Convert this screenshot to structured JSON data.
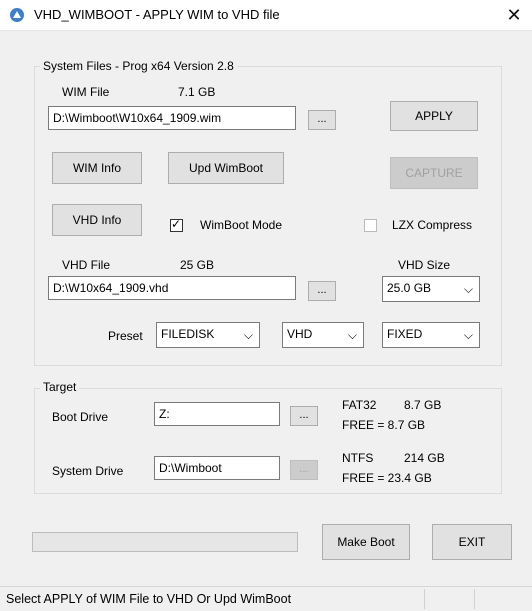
{
  "window": {
    "title": "VHD_WIMBOOT - APPLY WIM to VHD file",
    "close_glyph": "✕"
  },
  "system_files": {
    "legend": "System Files - Prog x64 Version 2.8",
    "wim_label": "WIM File",
    "wim_size": "7.1 GB",
    "wim_path": "D:\\Wimboot\\W10x64_1909.wim",
    "browse_label": "...",
    "apply_label": "APPLY",
    "wim_info_label": "WIM Info",
    "upd_wimboot_label": "Upd WimBoot",
    "capture_label": "CAPTURE",
    "vhd_info_label": "VHD Info",
    "wimboot_mode_label": "WimBoot Mode",
    "lzx_label": "LZX Compress",
    "vhd_label": "VHD File",
    "vhd_size": "25 GB",
    "vhd_size_label": "VHD Size",
    "vhd_path": "D:\\W10x64_1909.vhd",
    "vhd_size_value": "25.0 GB",
    "preset_label": "Preset",
    "preset_value": "FILEDISK",
    "type_value": "VHD",
    "mode_value": "FIXED",
    "chevron": "⌵",
    "check_glyph": "✓"
  },
  "target": {
    "legend": "Target",
    "boot_label": "Boot Drive",
    "boot_value": "Z:",
    "boot_fs": "FAT32",
    "boot_total": "8.7 GB",
    "boot_free": "FREE  = 8.7 GB",
    "system_label": "System Drive",
    "system_value": "D:\\Wimboot",
    "system_fs": "NTFS",
    "system_total": "214 GB",
    "system_free": "FREE  = 23.4 GB",
    "browse_label": "..."
  },
  "actions": {
    "make_boot_label": "Make Boot",
    "exit_label": "EXIT",
    "progress": 0
  },
  "status": {
    "text": "Select APPLY of WIM File to VHD Or Upd WimBoot"
  }
}
